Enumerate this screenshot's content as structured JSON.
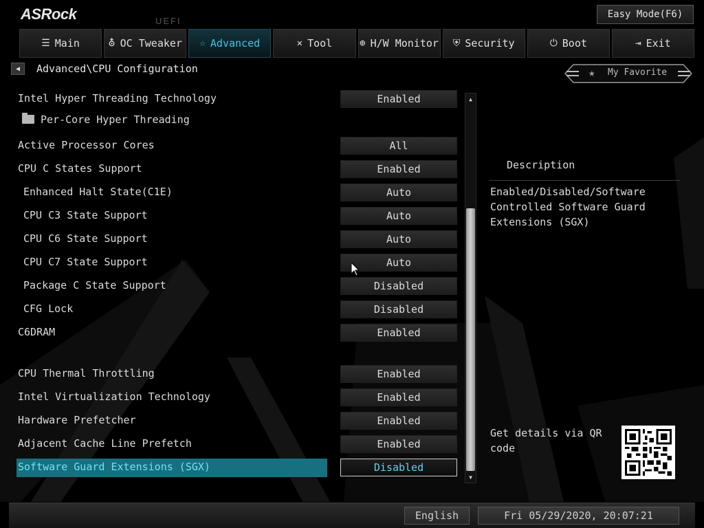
{
  "brand": {
    "logo": "ASRock",
    "uefi": "UEFI"
  },
  "easy_mode": "Easy Mode(F6)",
  "tabs": [
    {
      "label": "Main",
      "icon": "list-icon",
      "active": false
    },
    {
      "label": "OC Tweaker",
      "icon": "rocket-icon",
      "active": false
    },
    {
      "label": "Advanced",
      "icon": "star-icon",
      "active": true
    },
    {
      "label": "Tool",
      "icon": "tools-icon",
      "active": false
    },
    {
      "label": "H/W Monitor",
      "icon": "monitor-icon",
      "active": false
    },
    {
      "label": "Security",
      "icon": "shield-icon",
      "active": false
    },
    {
      "label": "Boot",
      "icon": "power-icon",
      "active": false
    },
    {
      "label": "Exit",
      "icon": "exit-icon",
      "active": false
    }
  ],
  "breadcrumb": "Advanced\\CPU Configuration",
  "favorite": "My Favorite",
  "settings": [
    {
      "label": "Intel Hyper Threading Technology",
      "value": "Enabled"
    },
    {
      "label": "Per-Core Hyper Threading",
      "value": "",
      "folder": true
    },
    {
      "label": "Active Processor Cores",
      "value": "All"
    },
    {
      "label": "CPU C States Support",
      "value": "Enabled"
    },
    {
      "label": "Enhanced Halt State(C1E)",
      "value": "Auto"
    },
    {
      "label": "CPU C3 State Support",
      "value": "Auto"
    },
    {
      "label": "CPU C6 State Support",
      "value": "Auto"
    },
    {
      "label": "CPU C7 State Support",
      "value": "Auto"
    },
    {
      "label": "Package C State Support",
      "value": "Disabled"
    },
    {
      "label": "CFG Lock",
      "value": "Disabled"
    },
    {
      "label": "C6DRAM",
      "value": "Enabled"
    },
    {
      "label": "CPU Thermal Throttling",
      "value": "Enabled"
    },
    {
      "label": "Intel Virtualization Technology",
      "value": "Enabled"
    },
    {
      "label": "Hardware Prefetcher",
      "value": "Enabled"
    },
    {
      "label": "Adjacent Cache Line Prefetch",
      "value": "Enabled"
    },
    {
      "label": "Software Guard Extensions (SGX)",
      "value": "Disabled",
      "selected": true
    }
  ],
  "description": {
    "title": "Description",
    "text": "Enabled/Disabled/Software Controlled Software Guard Extensions (SGX)",
    "qr_text": "Get details via QR code"
  },
  "footer": {
    "language": "English",
    "datetime": "Fri 05/29/2020, 20:07:21"
  },
  "colors": {
    "accent": "#3fc6e6",
    "selection": "#17707f",
    "background": "#000000"
  }
}
